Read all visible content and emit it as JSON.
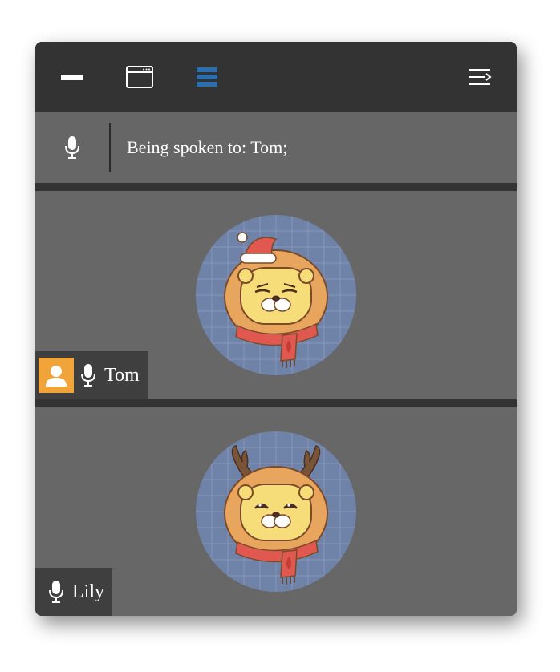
{
  "toolbar": {
    "buttons": [
      {
        "icon": "minimize-icon"
      },
      {
        "icon": "window-icon"
      },
      {
        "icon": "list-view-icon",
        "active": true,
        "color": "#2d6fae"
      },
      {
        "icon": "collapse-menu-icon"
      }
    ]
  },
  "speaking": {
    "text": "Being spoken to: Tom;"
  },
  "participants": [
    {
      "name": "Tom",
      "badge_icon": "user-icon",
      "badge_color": "#f0a43a",
      "avatar": "lion-santa-hat-avatar"
    },
    {
      "name": "Lily",
      "avatar": "lion-reindeer-antlers-avatar"
    }
  ],
  "colors": {
    "avatar_bg": "#6f82a8",
    "scarf": "#e0584f",
    "hood": "#e8a55e",
    "face": "#f7dd7a"
  }
}
